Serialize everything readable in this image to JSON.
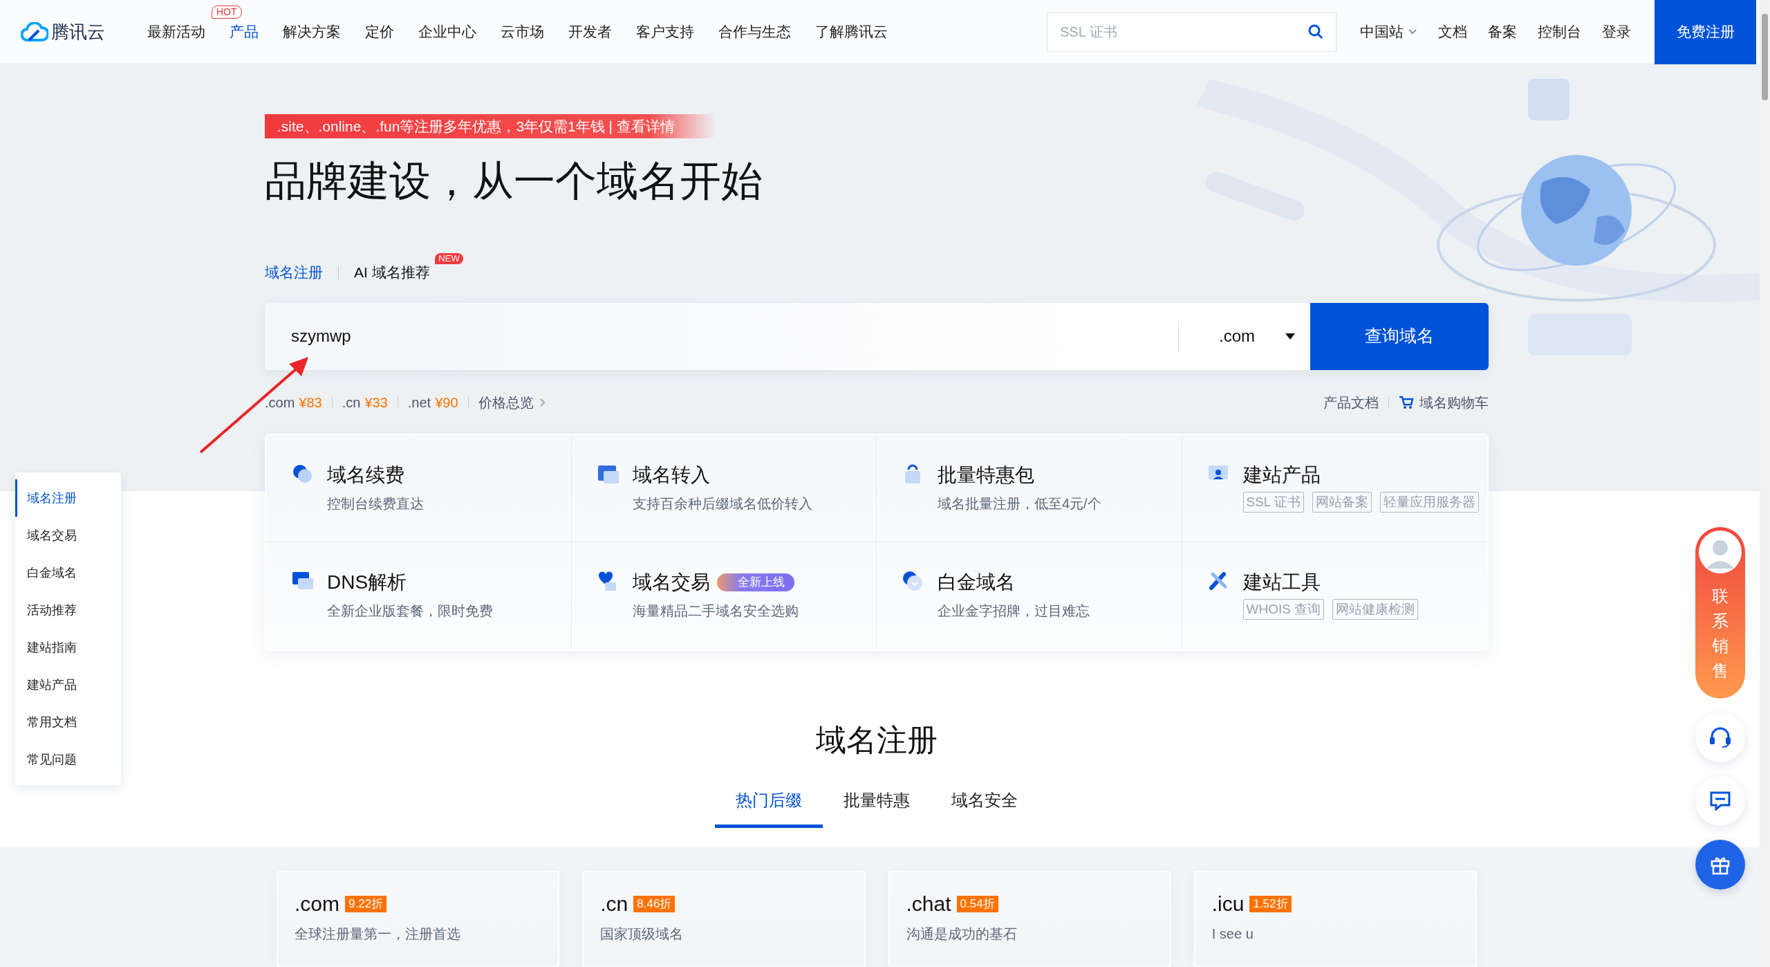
{
  "header": {
    "logo": "腾讯云",
    "nav": [
      {
        "label": "最新活动",
        "selected": false
      },
      {
        "label": "产品",
        "selected": true,
        "badge": "HOT"
      },
      {
        "label": "解决方案",
        "selected": false
      },
      {
        "label": "定价",
        "selected": false
      },
      {
        "label": "企业中心",
        "selected": false
      },
      {
        "label": "云市场",
        "selected": false
      },
      {
        "label": "开发者",
        "selected": false
      },
      {
        "label": "客户支持",
        "selected": false
      },
      {
        "label": "合作与生态",
        "selected": false
      },
      {
        "label": "了解腾讯云",
        "selected": false
      }
    ],
    "search": {
      "placeholder": "SSL 证书"
    },
    "region": "中国站",
    "links": [
      "文档",
      "备案",
      "控制台",
      "登录"
    ],
    "register_button": "免费注册"
  },
  "hero": {
    "promo": ".site、.online、.fun等注册多年优惠，3年仅需1年钱 | 查看详情",
    "title": "品牌建设，从一个域名开始",
    "tabs": [
      {
        "label": "域名注册",
        "selected": true
      },
      {
        "label": "AI 域名推荐",
        "selected": false,
        "badge": "NEW"
      }
    ],
    "search": {
      "value": "szymwp",
      "suffix": ".com",
      "button": "查询域名"
    },
    "prices": [
      {
        "suffix": ".com",
        "price": "¥83"
      },
      {
        "suffix": ".cn",
        "price": "¥33"
      },
      {
        "suffix": ".net",
        "price": "¥90"
      }
    ],
    "price_overview": "价格总览",
    "links": [
      "产品文档",
      "域名购物车"
    ]
  },
  "sidebar": [
    {
      "label": "域名注册",
      "selected": true
    },
    {
      "label": "域名交易",
      "selected": false
    },
    {
      "label": "白金域名",
      "selected": false
    },
    {
      "label": "活动推荐",
      "selected": false
    },
    {
      "label": "建站指南",
      "selected": false
    },
    {
      "label": "建站产品",
      "selected": false
    },
    {
      "label": "常用文档",
      "selected": false
    },
    {
      "label": "常见问题",
      "selected": false
    }
  ],
  "services": [
    {
      "title": "域名续费",
      "subtitle": "控制台续费直达"
    },
    {
      "title": "域名转入",
      "subtitle": "支持百余种后缀域名低价转入"
    },
    {
      "title": "批量特惠包",
      "subtitle": "域名批量注册，低至4元/个"
    },
    {
      "title": "建站产品",
      "tags": [
        "SSL 证书",
        "网站备案",
        "轻量应用服务器"
      ]
    },
    {
      "title": "DNS解析",
      "subtitle": "全新企业版套餐，限时免费"
    },
    {
      "title": "域名交易",
      "badge": "全新上线",
      "subtitle": "海量精品二手域名安全选购"
    },
    {
      "title": "白金域名",
      "subtitle": "企业金字招牌，过目难忘"
    },
    {
      "title": "建站工具",
      "tags": [
        "WHOIS 查询",
        "网站健康检测"
      ]
    }
  ],
  "section": {
    "title": "域名注册",
    "tabs": [
      {
        "label": "热门后缀",
        "selected": true
      },
      {
        "label": "批量特惠",
        "selected": false
      },
      {
        "label": "域名安全",
        "selected": false
      }
    ],
    "domains": [
      {
        "name": ".com",
        "discount": "9.22折",
        "description": "全球注册量第一，注册首选"
      },
      {
        "name": ".cn",
        "discount": "8.46折",
        "description": "国家顶级域名"
      },
      {
        "name": ".chat",
        "discount": "0.54折",
        "description": "沟通是成功的基石"
      },
      {
        "name": ".icu",
        "discount": "1.52折",
        "description": "I see u"
      }
    ]
  },
  "contact": {
    "label": "联系销售"
  }
}
